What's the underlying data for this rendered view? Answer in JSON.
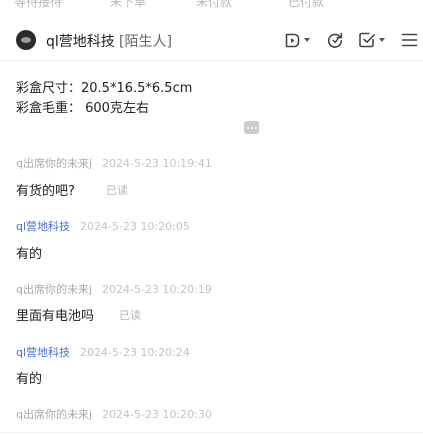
{
  "top_tabs": [
    "等待接待",
    "未下单",
    "未付款",
    "已付款"
  ],
  "header": {
    "contact_name": "ql营地科技",
    "contact_tag": "[陌生人]",
    "icons": [
      "avatar",
      "video-dropdown-icon",
      "transfer-icon",
      "order-dropdown-icon",
      "menu-icon"
    ]
  },
  "product_info": {
    "box_size": "彩盒尺寸：20.5*16.5*6.5cm",
    "box_weight": "彩盒毛重：  600克左右"
  },
  "messages": [
    {
      "sender": "q出席你的未来j",
      "role": "customer",
      "time": "2024-5-23 10:19:41",
      "text": "有货的吧?",
      "status": "已读"
    },
    {
      "sender": "ql营地科技",
      "role": "shop",
      "time": "2024-5-23 10:20:05",
      "text": "有的",
      "status": ""
    },
    {
      "sender": "q出席你的未来j",
      "role": "customer",
      "time": "2024-5-23 10:20:19",
      "text": "里面有电池吗",
      "status": "已读"
    },
    {
      "sender": "ql营地科技",
      "role": "shop",
      "time": "2024-5-23 10:20:24",
      "text": "有的",
      "status": ""
    },
    {
      "sender": "q出席你的未来j",
      "role": "customer",
      "time": "2024-5-23 10:20:30",
      "text": "",
      "status": ""
    }
  ],
  "colors": {
    "shop_sender": "#4a6fd6",
    "customer_sender": "#aaaaaa",
    "timestamp": "#c3c3c3",
    "text": "#222222",
    "read_status": "#b5b5b5"
  }
}
